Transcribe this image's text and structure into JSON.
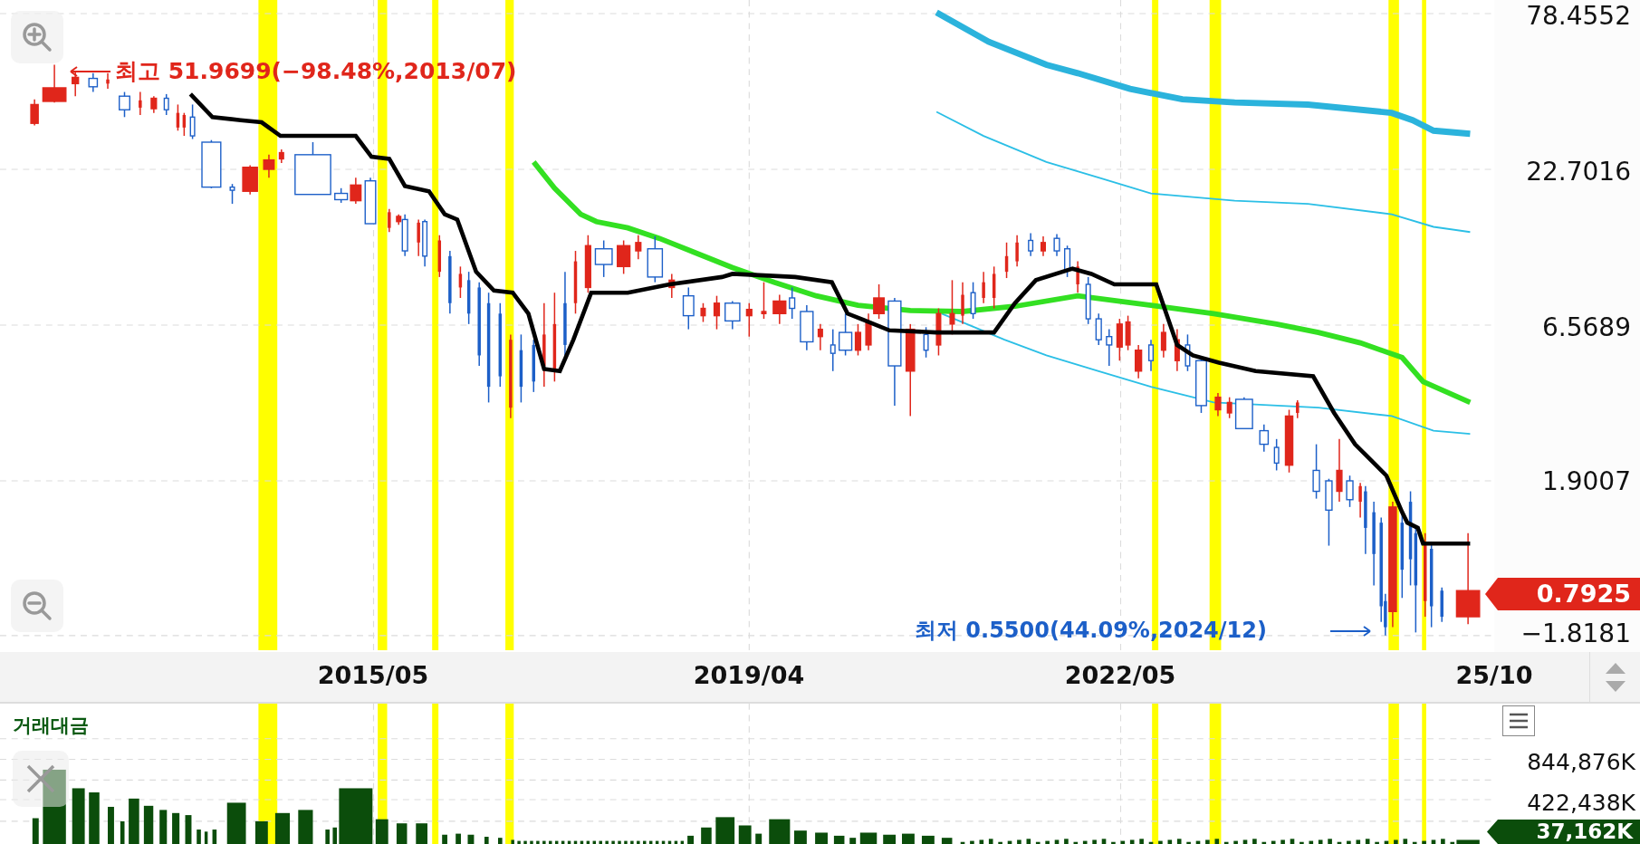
{
  "price_axis": {
    "labels": [
      "78.4552",
      "22.7016",
      "6.5689",
      "1.9007",
      "−1.8181"
    ]
  },
  "current_price": "0.7925",
  "high_marker": {
    "text": "최고 51.9699(−98.48%,2013/07)"
  },
  "low_marker": {
    "text": "최저 0.5500(44.09%,2024/12)"
  },
  "date_axis": {
    "labels": [
      "2015/05",
      "2019/04",
      "2022/05",
      "25/10"
    ]
  },
  "volume_panel": {
    "title": "거래대금",
    "axis_labels": [
      "844,876K",
      "422,438K"
    ],
    "current_value": "37,162K"
  }
}
